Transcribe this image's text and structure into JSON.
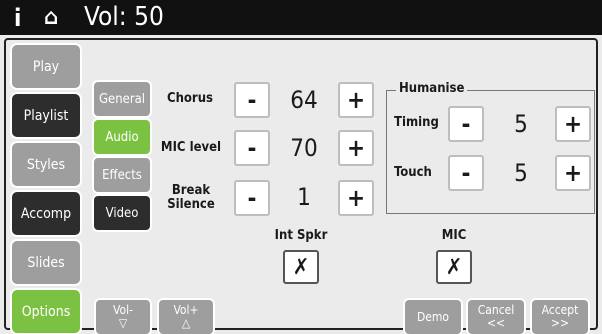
{
  "topbar": {
    "info_icon": "info-icon",
    "home_icon": "home-icon",
    "volume": "Vol: 50"
  },
  "nav": {
    "play": "Play",
    "playlist": "Playlist",
    "styles": "Styles",
    "accomp": "Accomp",
    "slides": "Slides",
    "options": "Options"
  },
  "subnav": {
    "general": "General",
    "audio": "Audio",
    "effects": "Effects",
    "video": "Video"
  },
  "controls": {
    "chorus": {
      "label": "Chorus",
      "value": "64"
    },
    "mic_level": {
      "label": "MIC level",
      "value": "70"
    },
    "break_silence": {
      "label_line1": "Break",
      "label_line2": "Silence",
      "value": "1"
    },
    "minus": "-",
    "plus": "+"
  },
  "humanise": {
    "title": "Humanise",
    "timing": {
      "label": "Timing",
      "value": "5"
    },
    "touch": {
      "label": "Touch",
      "value": "5"
    }
  },
  "toggles": {
    "int_spkr": {
      "label": "Int Spkr",
      "mark": "✗"
    },
    "mic": {
      "label": "MIC",
      "mark": "✗"
    }
  },
  "bottom": {
    "vol_down": {
      "line1": "Vol-",
      "line2": "▽"
    },
    "vol_up": {
      "line1": "Vol+",
      "line2": "△"
    },
    "demo": "Demo",
    "cancel": {
      "line1": "Cancel",
      "line2": "<<"
    },
    "accept": {
      "line1": "Accept",
      "line2": ">>"
    }
  }
}
